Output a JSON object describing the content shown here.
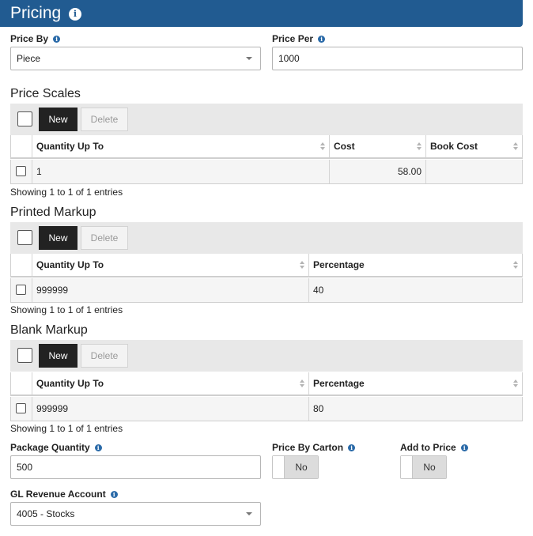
{
  "header": {
    "title": "Pricing",
    "info_glyph": "i"
  },
  "price_by": {
    "label": "Price By",
    "value": "Piece"
  },
  "price_per": {
    "label": "Price Per",
    "value": "1000"
  },
  "toolbar": {
    "new_label": "New",
    "delete_label": "Delete"
  },
  "price_scales": {
    "title": "Price Scales",
    "columns": [
      "Quantity Up To",
      "Cost",
      "Book Cost"
    ],
    "rows": [
      {
        "quantity": "1",
        "cost": "58.00",
        "book_cost": ""
      }
    ],
    "info": "Showing 1 to 1 of 1 entries"
  },
  "printed_markup": {
    "title": "Printed Markup",
    "columns": [
      "Quantity Up To",
      "Percentage"
    ],
    "rows": [
      {
        "quantity": "999999",
        "percentage": "40"
      }
    ],
    "info": "Showing 1 to 1 of 1 entries"
  },
  "blank_markup": {
    "title": "Blank Markup",
    "columns": [
      "Quantity Up To",
      "Percentage"
    ],
    "rows": [
      {
        "quantity": "999999",
        "percentage": "80"
      }
    ],
    "info": "Showing 1 to 1 of 1 entries"
  },
  "package_quantity": {
    "label": "Package Quantity",
    "value": "500"
  },
  "price_by_carton": {
    "label": "Price By Carton",
    "state": "No"
  },
  "add_to_price": {
    "label": "Add to Price",
    "state": "No"
  },
  "gl_revenue_account": {
    "label": "GL Revenue Account",
    "value": "4005 - Stocks"
  },
  "icons": {
    "info": "info-circle-icon",
    "caret": "chevron-down-icon",
    "sort": "sort-icon"
  },
  "colors": {
    "header_bg": "#215b91",
    "info_icon": "#2a6aa8",
    "button_primary": "#222222",
    "toolbar_bg": "#e8e8e8"
  }
}
